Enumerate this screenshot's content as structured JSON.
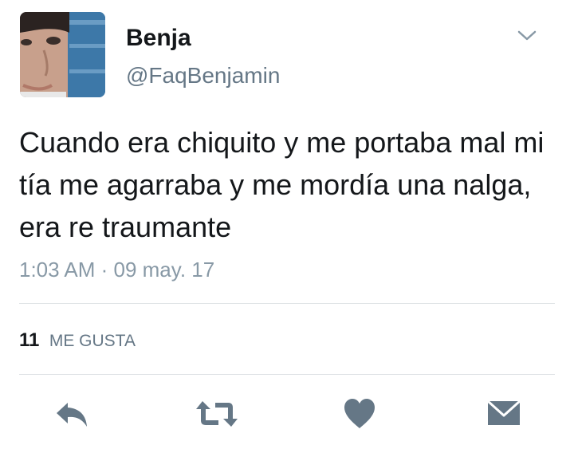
{
  "tweet": {
    "display_name": "Benja",
    "handle": "@FaqBenjamin",
    "text": "Cuando era chiquito y me portaba mal mi tía me agarraba y me mordía una nalga, era re traumante",
    "timestamp": "1:03 AM · 09 may. 17"
  },
  "stats": {
    "likes_count": "11",
    "likes_label": "ME GUSTA"
  },
  "icons": {
    "menu": "chevron-down-icon",
    "reply": "reply-icon",
    "retweet": "retweet-icon",
    "like": "heart-icon",
    "message": "envelope-icon"
  },
  "colors": {
    "icon": "#657786",
    "secondary_text": "#657786",
    "divider": "#dfe3e6"
  }
}
